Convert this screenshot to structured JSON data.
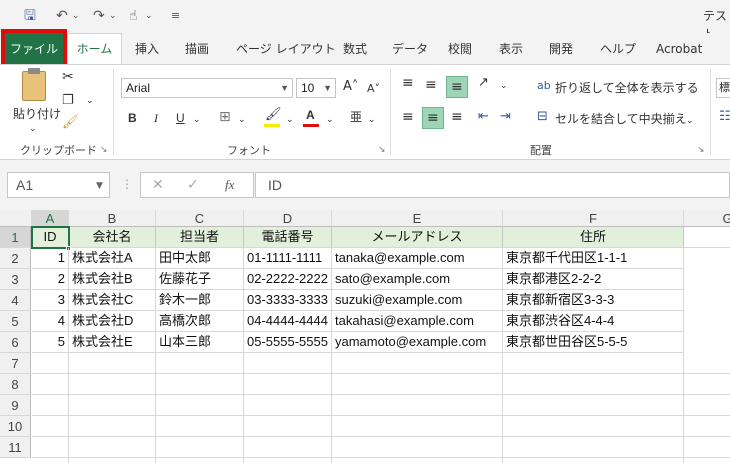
{
  "title_partial": "テスト",
  "quick_access": {
    "save_icon": "save-icon",
    "undo_icon": "undo-icon",
    "redo_icon": "redo-icon",
    "touch_icon": "touch-mode-icon"
  },
  "tabs": {
    "file": "ファイル",
    "home": "ホーム",
    "items": [
      "挿入",
      "描画",
      "ページ レイアウト",
      "数式",
      "データ",
      "校閲",
      "表示",
      "開発",
      "ヘルプ",
      "Acrobat"
    ]
  },
  "ribbon": {
    "clipboard": {
      "paste_label": "貼り付け",
      "group_label": "クリップボード"
    },
    "font": {
      "font_name": "Arial",
      "font_size": "10",
      "group_label": "フォント",
      "bold": "B",
      "italic": "I",
      "underline": "U"
    },
    "alignment": {
      "wrap_text": "折り返して全体を表示する",
      "merge_center": "セルを結合して中央揃え",
      "group_label": "配置"
    },
    "next_group_partial": "標"
  },
  "formula_bar": {
    "name_box": "A1",
    "formula": "ID",
    "fx_label": "fx"
  },
  "colors": {
    "accent": "#217346",
    "file_highlight": "#e00d0d",
    "header_fill": "#e2efda"
  },
  "columns": [
    "A",
    "B",
    "C",
    "D",
    "E",
    "F",
    "G"
  ],
  "row_numbers": [
    "1",
    "2",
    "3",
    "4",
    "5",
    "6",
    "7",
    "8",
    "9",
    "10",
    "11"
  ],
  "sheet": {
    "headers": [
      "ID",
      "会社名",
      "担当者",
      "電話番号",
      "メールアドレス",
      "住所"
    ],
    "rows": [
      [
        "1",
        "株式会社A",
        "田中太郎",
        "01-1111-1111",
        "tanaka@example.com",
        "東京都千代田区1-1-1"
      ],
      [
        "2",
        "株式会社B",
        "佐藤花子",
        "02-2222-2222",
        "sato@example.com",
        "東京都港区2-2-2"
      ],
      [
        "3",
        "株式会社C",
        "鈴木一郎",
        "03-3333-3333",
        "suzuki@example.com",
        "東京都新宿区3-3-3"
      ],
      [
        "4",
        "株式会社D",
        "高橋次郎",
        "04-4444-4444",
        "takahasi@example.com",
        "東京都渋谷区4-4-4"
      ],
      [
        "5",
        "株式会社E",
        "山本三郎",
        "05-5555-5555",
        "yamamoto@example.com",
        "東京都世田谷区5-5-5"
      ]
    ]
  }
}
